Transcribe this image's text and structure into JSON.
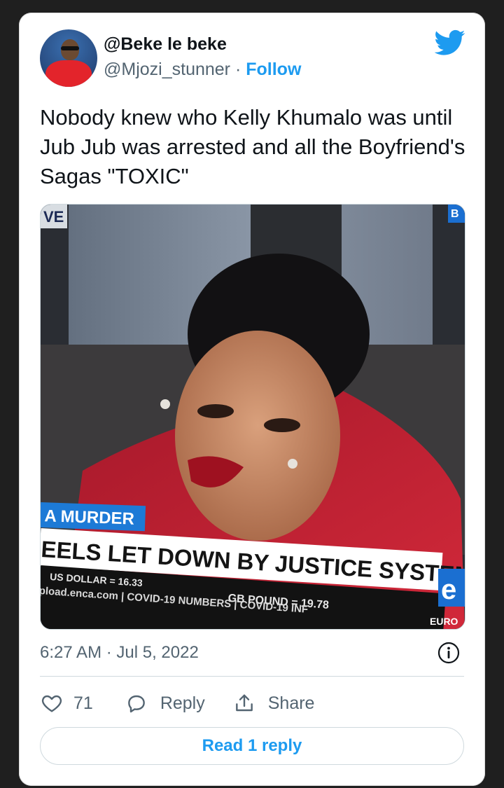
{
  "user": {
    "display_name": "@Beke le beke",
    "handle": "@Mjozi_stunner",
    "separator": " · ",
    "follow_label": "Follow"
  },
  "tweet": {
    "text": "Nobody knew who Kelly Khumalo was until Jub Jub was arrested and all the Boyfriend's Sagas \"TOXIC\"",
    "timestamp": "6:27 AM · Jul 5, 2022"
  },
  "media": {
    "live_tag": "VE",
    "corner_tag": "B",
    "lower_third_label": "A MURDER",
    "headline": "EELS LET DOWN BY JUSTICE SYSTEM",
    "ticker_usd": "US DOLLAR = 16.33",
    "ticker_gbp": "GB POUND = 19.78",
    "ticker_line": "pload.enca.com  |  COVID-19 NUMBERS  |  COVID-19 INF",
    "channel_logo": "e",
    "euro_label": "EURO"
  },
  "actions": {
    "like_count": "71",
    "reply_label": "Reply",
    "share_label": "Share",
    "read_reply_label": "Read 1 reply"
  },
  "colors": {
    "accent": "#1d9bf0",
    "text": "#0f1419",
    "secondary": "#536471",
    "border": "#cfd9de"
  }
}
